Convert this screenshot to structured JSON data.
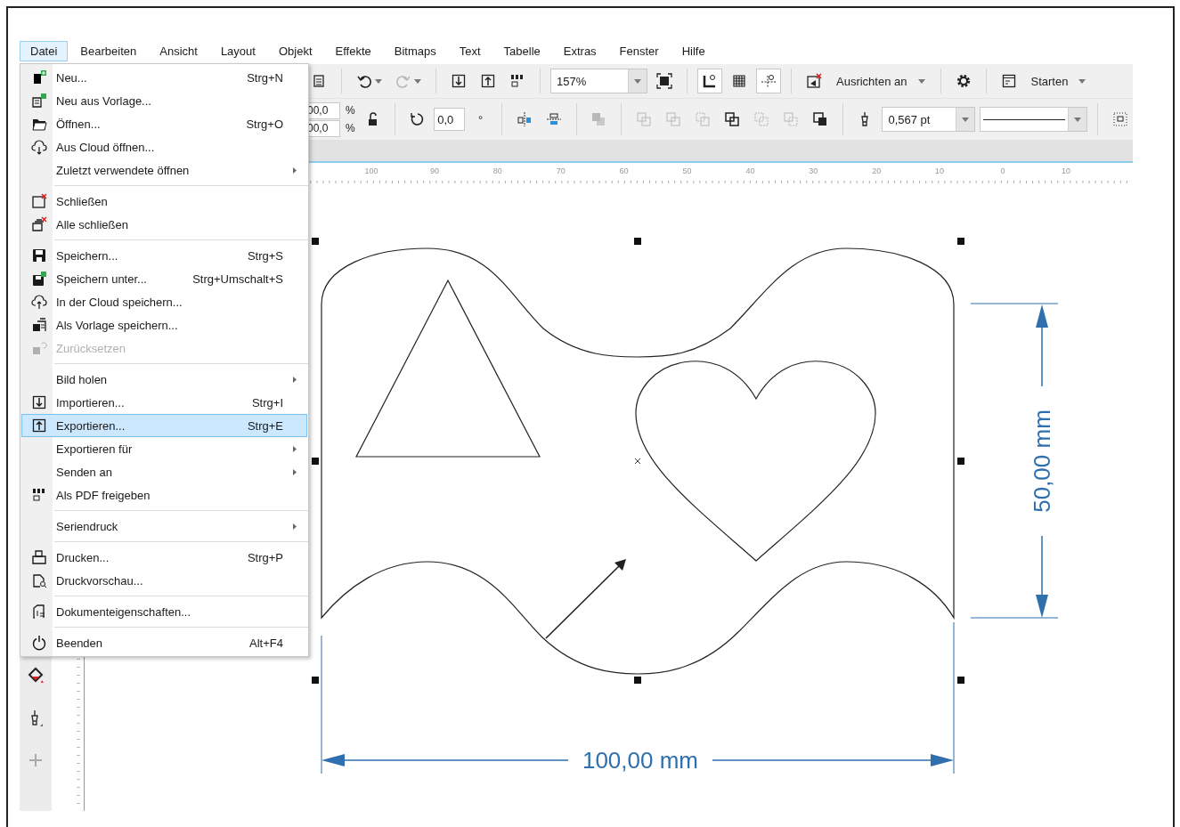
{
  "menubar": [
    {
      "label": "Datei",
      "selected": true
    },
    {
      "label": "Bearbeiten",
      "selected": false
    },
    {
      "label": "Ansicht",
      "selected": false
    },
    {
      "label": "Layout",
      "selected": false
    },
    {
      "label": "Objekt",
      "selected": false
    },
    {
      "label": "Effekte",
      "selected": false
    },
    {
      "label": "Bitmaps",
      "selected": false
    },
    {
      "label": "Text",
      "selected": false
    },
    {
      "label": "Tabelle",
      "selected": false
    },
    {
      "label": "Extras",
      "selected": false
    },
    {
      "label": "Fenster",
      "selected": false
    },
    {
      "label": "Hilfe",
      "selected": false
    }
  ],
  "toolbar_1": [
    {
      "kind": "icon",
      "disabled": false
    },
    {
      "kind": "separator"
    },
    {
      "kind": "icon-dropdown",
      "disabled": false
    },
    {
      "kind": "icon-dropdown",
      "disabled": true
    },
    {
      "kind": "separator"
    },
    {
      "kind": "icon",
      "disabled": false
    },
    {
      "kind": "icon",
      "disabled": false
    },
    {
      "kind": "icon",
      "disabled": false
    },
    {
      "kind": "separator"
    },
    {
      "kind": "combo",
      "value": "157%"
    },
    {
      "kind": "icon",
      "disabled": false
    },
    {
      "kind": "separator"
    },
    {
      "kind": "toggle",
      "on": true
    },
    {
      "kind": "toggle",
      "on": false
    },
    {
      "kind": "toggle",
      "on": true
    },
    {
      "kind": "separator"
    },
    {
      "kind": "icon",
      "disabled": false
    },
    {
      "kind": "menu",
      "label": "Ausrichten an"
    },
    {
      "kind": "separator"
    },
    {
      "kind": "icon",
      "disabled": false
    },
    {
      "kind": "separator"
    },
    {
      "kind": "icon",
      "disabled": false
    },
    {
      "kind": "menu",
      "label": "Starten"
    }
  ],
  "toolbar_2": [
    {
      "kind": "scale",
      "rows": [
        {
          "value": "00,0",
          "unit": "%"
        },
        {
          "value": "00,0",
          "unit": "%"
        }
      ]
    },
    {
      "kind": "icon",
      "disabled": false
    },
    {
      "kind": "separator"
    },
    {
      "kind": "icon",
      "disabled": false
    },
    {
      "kind": "field",
      "value": "0,0"
    },
    {
      "kind": "unit",
      "label": "°"
    },
    {
      "kind": "separator"
    },
    {
      "kind": "icon",
      "disabled": false
    },
    {
      "kind": "icon",
      "disabled": false
    },
    {
      "kind": "separator"
    },
    {
      "kind": "icon",
      "disabled": true
    },
    {
      "kind": "separator"
    },
    {
      "kind": "icon",
      "disabled": true
    },
    {
      "kind": "icon",
      "disabled": true
    },
    {
      "kind": "icon",
      "disabled": true
    },
    {
      "kind": "icon",
      "disabled": false
    },
    {
      "kind": "icon",
      "disabled": true
    },
    {
      "kind": "icon",
      "disabled": true
    },
    {
      "kind": "icon",
      "disabled": false
    },
    {
      "kind": "separator"
    },
    {
      "kind": "icon",
      "disabled": false
    },
    {
      "kind": "combo",
      "value": "0,567 pt"
    },
    {
      "kind": "line-combo"
    },
    {
      "kind": "separator"
    },
    {
      "kind": "icon",
      "disabled": false
    }
  ],
  "ruler_labels": [
    "100",
    "90",
    "80",
    "70",
    "60",
    "50",
    "40",
    "30",
    "20",
    "10",
    "0",
    "10"
  ],
  "file_menu": [
    {
      "kind": "item",
      "label": "Neu...",
      "shortcut": "Strg+N",
      "submenu": false,
      "disabled": false,
      "selected": false
    },
    {
      "kind": "item",
      "label": "Neu aus Vorlage...",
      "submenu": false,
      "disabled": false,
      "selected": false
    },
    {
      "kind": "item",
      "label": "Öffnen...",
      "shortcut": "Strg+O",
      "submenu": false,
      "disabled": false,
      "selected": false
    },
    {
      "kind": "item",
      "label": "Aus Cloud öffnen...",
      "submenu": false,
      "disabled": false,
      "selected": false
    },
    {
      "kind": "item",
      "label": "Zuletzt verwendete öffnen",
      "submenu": true,
      "disabled": false,
      "selected": false
    },
    {
      "kind": "separator"
    },
    {
      "kind": "item",
      "label": "Schließen",
      "submenu": false,
      "disabled": false,
      "selected": false
    },
    {
      "kind": "item",
      "label": "Alle schließen",
      "submenu": false,
      "disabled": false,
      "selected": false
    },
    {
      "kind": "separator"
    },
    {
      "kind": "item",
      "label": "Speichern...",
      "shortcut": "Strg+S",
      "submenu": false,
      "disabled": false,
      "selected": false
    },
    {
      "kind": "item",
      "label": "Speichern unter...",
      "shortcut": "Strg+Umschalt+S",
      "submenu": false,
      "disabled": false,
      "selected": false
    },
    {
      "kind": "item",
      "label": "In der Cloud speichern...",
      "submenu": false,
      "disabled": false,
      "selected": false
    },
    {
      "kind": "item",
      "label": "Als Vorlage speichern...",
      "submenu": false,
      "disabled": false,
      "selected": false
    },
    {
      "kind": "item",
      "label": "Zurücksetzen",
      "submenu": false,
      "disabled": true,
      "selected": false
    },
    {
      "kind": "separator"
    },
    {
      "kind": "item",
      "label": "Bild holen",
      "submenu": true,
      "disabled": false,
      "selected": false
    },
    {
      "kind": "item",
      "label": "Importieren...",
      "shortcut": "Strg+I",
      "submenu": false,
      "disabled": false,
      "selected": false
    },
    {
      "kind": "item",
      "label": "Exportieren...",
      "shortcut": "Strg+E",
      "submenu": false,
      "disabled": false,
      "selected": true
    },
    {
      "kind": "item",
      "label": "Exportieren für",
      "submenu": true,
      "disabled": false,
      "selected": false
    },
    {
      "kind": "item",
      "label": "Senden an",
      "submenu": true,
      "disabled": false,
      "selected": false
    },
    {
      "kind": "item",
      "label": "Als PDF freigeben",
      "submenu": false,
      "disabled": false,
      "selected": false
    },
    {
      "kind": "separator"
    },
    {
      "kind": "item",
      "label": "Seriendruck",
      "submenu": true,
      "disabled": false,
      "selected": false
    },
    {
      "kind": "separator"
    },
    {
      "kind": "item",
      "label": "Drucken...",
      "shortcut": "Strg+P",
      "submenu": false,
      "disabled": false,
      "selected": false
    },
    {
      "kind": "item",
      "label": "Druckvorschau...",
      "submenu": false,
      "disabled": false,
      "selected": false
    },
    {
      "kind": "separator"
    },
    {
      "kind": "item",
      "label": "Dokumenteigenschaften...",
      "submenu": false,
      "disabled": false,
      "selected": false
    },
    {
      "kind": "separator"
    },
    {
      "kind": "item",
      "label": "Beenden",
      "shortcut": "Alt+F4",
      "submenu": false,
      "disabled": false,
      "selected": false
    }
  ],
  "drawing": {
    "width_label": "100,00 mm",
    "height_label": "50,00 mm"
  }
}
